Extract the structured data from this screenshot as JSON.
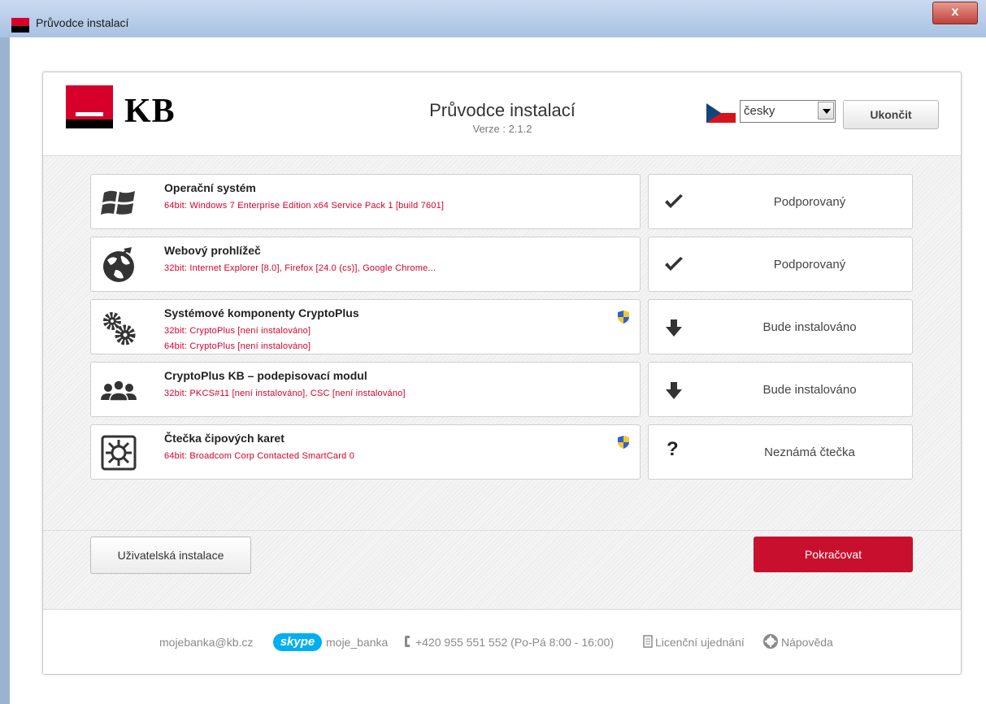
{
  "window": {
    "title": "Průvodce instalací",
    "close_glyph": "x"
  },
  "header": {
    "logo_text": "KB",
    "title": "Průvodce instalací",
    "version": "Verze : 2.1.2",
    "language": "česky",
    "exit_label": "Ukončit"
  },
  "components": [
    {
      "icon": "windows-logo-icon",
      "title": "Operační systém",
      "lines": [
        "64bit: Windows 7 Enterprise Edition x64 Service Pack 1 [build 7601]"
      ],
      "admin_shield": false,
      "status_icon": "checkmark-icon",
      "status": "Podporovaný"
    },
    {
      "icon": "globe-icon",
      "title": "Webový prohlížeč",
      "lines": [
        "32bit: Internet Explorer [8.0], Firefox [24.0 (cs)], Google Chrome..."
      ],
      "admin_shield": false,
      "status_icon": "checkmark-icon",
      "status": "Podporovaný"
    },
    {
      "icon": "gears-icon",
      "title": "Systémové komponenty CryptoPlus",
      "lines": [
        "32bit: CryptoPlus [není instalováno]",
        "64bit: CryptoPlus [není instalováno]"
      ],
      "admin_shield": true,
      "status_icon": "arrow-down-icon",
      "status": "Bude instalováno"
    },
    {
      "icon": "users-group-icon",
      "title": "CryptoPlus KB – podepisovací modul",
      "lines": [
        "32bit: PKCS#11 [není instalováno], CSC [není instalováno]"
      ],
      "admin_shield": false,
      "status_icon": "arrow-down-icon",
      "status": "Bude instalováno"
    },
    {
      "icon": "smartcard-chip-icon",
      "title": "Čtečka čipových karet",
      "lines": [
        "64bit: Broadcom Corp Contacted SmartCard 0"
      ],
      "admin_shield": true,
      "status_icon": "question-mark-icon",
      "status": "Neznámá čtečka",
      "status_glyph": "?"
    }
  ],
  "buttons": {
    "custom_install": "Uživatelská instalace",
    "continue": "Pokračovat"
  },
  "footer": {
    "email": "mojebanka@kb.cz",
    "skype_logo": "skype",
    "skype_name": "moje_banka",
    "phone": "+420 955 551 552 (Po-Pá 8:00 - 16:00)",
    "license": "Licenční ujednání",
    "help": "Nápověda"
  },
  "colors": {
    "brand_red": "#d6002b",
    "button_red": "#c8102e",
    "detail_red": "#d6002b",
    "skype_blue": "#00aff0"
  }
}
